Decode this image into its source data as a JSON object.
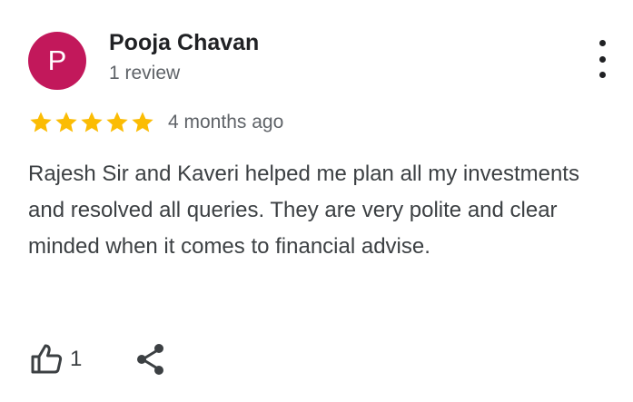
{
  "review": {
    "avatar_letter": "P",
    "avatar_color": "#c2185b",
    "author": "Pooja Chavan",
    "author_meta": "1 review",
    "rating": 5,
    "rating_max": 5,
    "star_color": "#fbbc04",
    "time": "4 months ago",
    "text": "Rajesh Sir and Kaveri helped me plan all my investments and resolved all queries. They are very polite and clear minded when it comes to financial advise.",
    "likes": "1"
  },
  "icons": {
    "more": "more-vert-icon",
    "like": "thumb-up-icon",
    "share": "share-icon",
    "star": "star-icon"
  }
}
